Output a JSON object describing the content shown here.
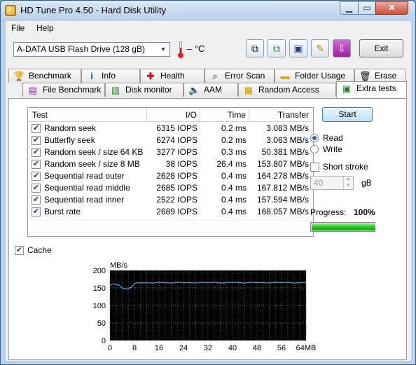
{
  "window": {
    "title": "HD Tune Pro 4.50 - Hard Disk Utility"
  },
  "menu": [
    {
      "label": "File"
    },
    {
      "label": "Help"
    }
  ],
  "toolbar": {
    "drive": "A-DATA USB Flash Drive   (128 gB)",
    "temperature": "– °C",
    "exit_label": "Exit"
  },
  "tabs_top": [
    {
      "label": "Benchmark",
      "icon": "benchmark-icon"
    },
    {
      "label": "Info",
      "icon": "info-icon"
    },
    {
      "label": "Health",
      "icon": "health-cross-icon"
    },
    {
      "label": "Error Scan",
      "icon": "error-scan-icon"
    },
    {
      "label": "Folder Usage",
      "icon": "folder-icon"
    },
    {
      "label": "Erase",
      "icon": "trash-icon"
    }
  ],
  "tabs_bottom": [
    {
      "label": "File Benchmark",
      "icon": "file-benchmark-icon"
    },
    {
      "label": "Disk monitor",
      "icon": "disk-monitor-icon"
    },
    {
      "label": "AAM",
      "icon": "speaker-icon"
    },
    {
      "label": "Random Access",
      "icon": "random-access-icon"
    },
    {
      "label": "Extra tests",
      "icon": "extra-tests-icon"
    }
  ],
  "table": {
    "headers": [
      "Test",
      "I/O",
      "Time",
      "Transfer"
    ],
    "rows": [
      {
        "name": "Random seek",
        "io": "6315 IOPS",
        "time": "0.2 ms",
        "transfer": "3.083 MB/s"
      },
      {
        "name": "Butterfly seek",
        "io": "6274 IOPS",
        "time": "0.2 ms",
        "transfer": "3.063 MB/s"
      },
      {
        "name": "Random seek / size 64 KB",
        "io": "3277 IOPS",
        "time": "0.3 ms",
        "transfer": "50.381 MB/s"
      },
      {
        "name": "Random seek / size 8 MB",
        "io": "38 IOPS",
        "time": "26.4 ms",
        "transfer": "153.807 MB/s"
      },
      {
        "name": "Sequential read outer",
        "io": "2628 IOPS",
        "time": "0.4 ms",
        "transfer": "164.278 MB/s"
      },
      {
        "name": "Sequential read middle",
        "io": "2685 IOPS",
        "time": "0.4 ms",
        "transfer": "167.812 MB/s"
      },
      {
        "name": "Sequential read inner",
        "io": "2522 IOPS",
        "time": "0.4 ms",
        "transfer": "157.594 MB/s"
      },
      {
        "name": "Burst rate",
        "io": "2689 IOPS",
        "time": "0.4 ms",
        "transfer": "168.057 MB/s"
      }
    ]
  },
  "controls": {
    "start_label": "Start",
    "read_label": "Read",
    "write_label": "Write",
    "short_stroke_label": "Short stroke",
    "stroke_value": "40",
    "stroke_unit": "gB",
    "progress_label": "Progress:",
    "progress_text": "100%",
    "progress_fraction": 1.0,
    "cache_label": "Cache"
  },
  "chart_data": {
    "type": "line",
    "ylabel": "MB/s",
    "ylim": [
      0,
      200
    ],
    "yticks": [
      0,
      50,
      100,
      150,
      200
    ],
    "xlim": [
      0,
      64
    ],
    "xticks": [
      "0",
      "8",
      "16",
      "24",
      "32",
      "40",
      "48",
      "56",
      "64MB"
    ],
    "grid": true,
    "series": [
      {
        "color": "#4aa8e8",
        "x": [
          0,
          1,
          2,
          3,
          4,
          5,
          6,
          7,
          8,
          9,
          10,
          12,
          14,
          16,
          18,
          20,
          22,
          24,
          26,
          28,
          30,
          32,
          34,
          36,
          38,
          40,
          42,
          44,
          46,
          48,
          50,
          52,
          54,
          56,
          58,
          60,
          62,
          64
        ],
        "y": [
          157,
          162,
          160,
          158,
          150,
          147,
          148,
          152,
          163,
          165,
          164,
          165,
          164,
          166,
          165,
          164,
          166,
          165,
          165,
          164,
          166,
          165,
          166,
          164,
          165,
          166,
          165,
          164,
          166,
          165,
          165,
          164,
          166,
          165,
          166,
          164,
          165,
          165
        ]
      }
    ]
  }
}
